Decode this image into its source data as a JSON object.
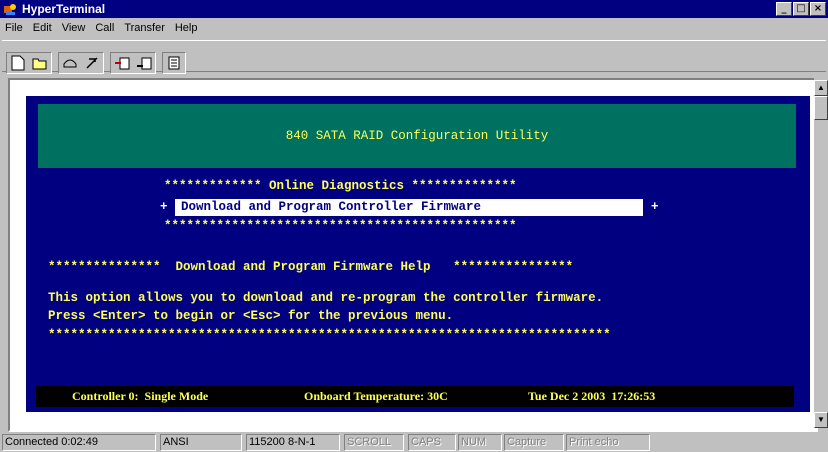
{
  "window": {
    "title": "HyperTerminal"
  },
  "menu": [
    "File",
    "Edit",
    "View",
    "Call",
    "Transfer",
    "Help"
  ],
  "toolbar": {
    "buttons": [
      "new-icon",
      "open-icon",
      "connect-icon",
      "disconnect-icon",
      "send-icon",
      "receive-icon",
      "properties-icon"
    ]
  },
  "terminal": {
    "header": "840 SATA RAID Configuration Utility",
    "menu_title_line": "************* Online Diagnostics **************",
    "selected_left": "+",
    "selected_item": "Download and Program Controller Firmware",
    "selected_right": "+",
    "menu_bottom_line": "***********************************************",
    "help_title_line": "***************  Download and Program Firmware Help   ****************",
    "help_line1": "This option allows you to download and re-program the controller firmware.",
    "help_line2": "Press <Enter> to begin or <Esc> for the previous menu.",
    "help_bottom_line": "***************************************************************************",
    "status": {
      "controller": "Controller 0:  Single Mode",
      "temperature": "Onboard Temperature: 30C",
      "datetime": "Tue Dec 2 2003  17:26:53"
    }
  },
  "statusbar": {
    "connected": "Connected 0:02:49",
    "emulation": "ANSI",
    "port_settings": "115200 8-N-1",
    "scroll": "SCROLL",
    "caps": "CAPS",
    "num": "NUM",
    "capture": "Capture",
    "print_echo": "Print echo"
  }
}
